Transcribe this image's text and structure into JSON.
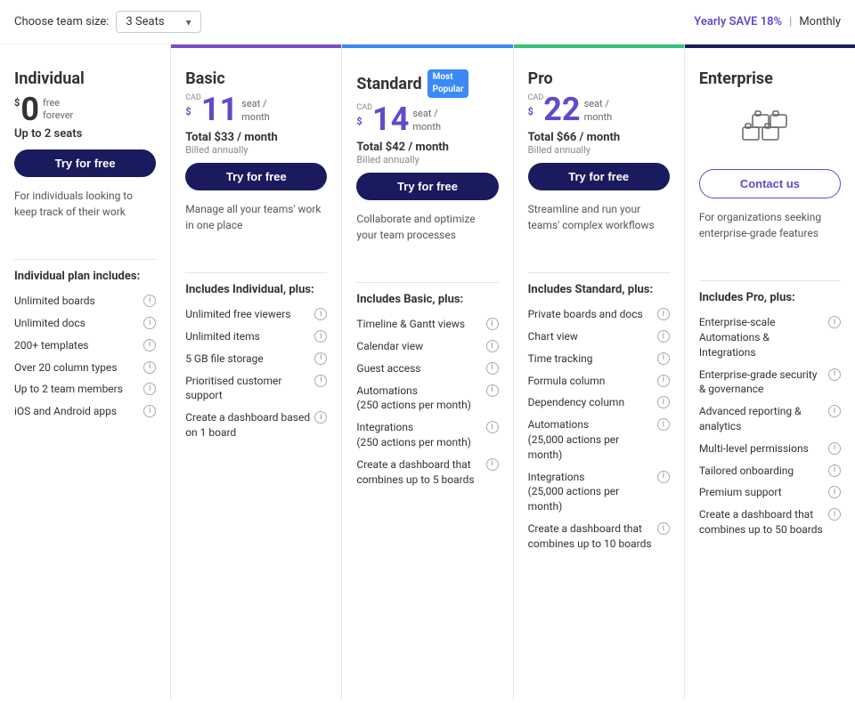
{
  "topBar": {
    "teamSizeLabel": "Choose team size:",
    "teamSizeValue": "3 Seats",
    "yearlyLabel": "Yearly SAVE 18%",
    "divider": "|",
    "monthlyLabel": "Monthly"
  },
  "plans": [
    {
      "id": "individual",
      "name": "Individual",
      "colorClass": "individual",
      "currency": "$",
      "cad": "",
      "price": "0",
      "priceFree": true,
      "freeLabel": "free\nforever",
      "priceUnit": "",
      "totalPrice": "",
      "billedAnnually": "",
      "seatsLabel": "Up to 2 seats",
      "buttonLabel": "Try for free",
      "buttonType": "try",
      "description": "For individuals looking to keep track of their work",
      "includesTitle": "Individual plan includes:",
      "features": [
        "Unlimited boards",
        "Unlimited docs",
        "200+ templates",
        "Over 20 column types",
        "Up to 2 team members",
        "iOS and Android apps"
      ]
    },
    {
      "id": "basic",
      "name": "Basic",
      "colorClass": "basic",
      "currency": "$",
      "cad": "CAD",
      "price": "11",
      "priceFree": false,
      "priceUnit": "seat /\nmonth",
      "totalPrice": "Total $33 / month",
      "billedAnnually": "Billed annually",
      "seatsLabel": "",
      "buttonLabel": "Try for free",
      "buttonType": "try",
      "description": "Manage all your teams' work in one place",
      "includesTitle": "Includes Individual, plus:",
      "features": [
        "Unlimited free viewers",
        "Unlimited items",
        "5 GB file storage",
        "Prioritised customer support",
        "Create a dashboard based on 1 board"
      ]
    },
    {
      "id": "standard",
      "name": "Standard",
      "colorClass": "standard",
      "mostPopular": true,
      "currency": "$",
      "cad": "CAD",
      "price": "14",
      "priceFree": false,
      "priceUnit": "seat /\nmonth",
      "totalPrice": "Total $42 / month",
      "billedAnnually": "Billed annually",
      "seatsLabel": "",
      "buttonLabel": "Try for free",
      "buttonType": "try",
      "description": "Collaborate and optimize your team processes",
      "includesTitle": "Includes Basic, plus:",
      "features": [
        "Timeline & Gantt views",
        "Calendar view",
        "Guest access",
        "Automations\n(250 actions per month)",
        "Integrations\n(250 actions per month)",
        "Create a dashboard that combines up to 5 boards"
      ]
    },
    {
      "id": "pro",
      "name": "Pro",
      "colorClass": "pro",
      "currency": "$",
      "cad": "CAD",
      "price": "22",
      "priceFree": false,
      "priceUnit": "seat /\nmonth",
      "totalPrice": "Total $66 / month",
      "billedAnnually": "Billed annually",
      "seatsLabel": "",
      "buttonLabel": "Try for free",
      "buttonType": "try",
      "description": "Streamline and run your teams' complex workflows",
      "includesTitle": "Includes Standard, plus:",
      "features": [
        "Private boards and docs",
        "Chart view",
        "Time tracking",
        "Formula column",
        "Dependency column",
        "Automations\n(25,000 actions per month)",
        "Integrations\n(25,000 actions per month)",
        "Create a dashboard that combines up to 10 boards"
      ]
    },
    {
      "id": "enterprise",
      "name": "Enterprise",
      "colorClass": "enterprise",
      "currency": "",
      "cad": "",
      "price": "",
      "priceFree": false,
      "priceUnit": "",
      "totalPrice": "",
      "billedAnnually": "",
      "seatsLabel": "",
      "buttonLabel": "Contact us",
      "buttonType": "contact",
      "description": "For organizations seeking enterprise-grade features",
      "includesTitle": "Includes Pro, plus:",
      "features": [
        "Enterprise-scale Automations & Integrations",
        "Enterprise-grade security & governance",
        "Advanced reporting & analytics",
        "Multi-level permissions",
        "Tailored onboarding",
        "Premium support",
        "Create a dashboard that combines up to 50 boards"
      ]
    }
  ]
}
